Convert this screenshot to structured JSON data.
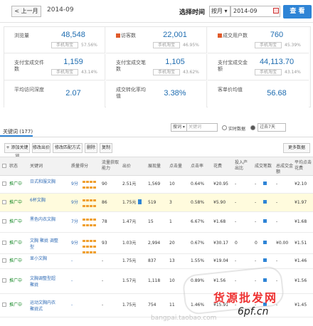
{
  "topbar": {
    "prev_label": "< 上一月",
    "period": "2014-09",
    "picker_title": "选择时间",
    "mode": "按月 ▾",
    "date_value": "2014-09",
    "query_label": "查 看"
  },
  "metrics": [
    {
      "label": "浏览量",
      "value": "48,548",
      "badge": "手机淘宝",
      "pct": "57.56%"
    },
    {
      "label": "访客数",
      "value": "22,001",
      "badge": "手机淘宝",
      "pct": "46.95%"
    },
    {
      "label": "成交用户数",
      "value": "760",
      "badge": "手机淘宝",
      "pct": "45.39%"
    },
    {
      "label": "支付宝成交件数",
      "value": "1,159",
      "badge": "手机淘宝",
      "pct": "43.14%"
    },
    {
      "label": "支付宝成交笔数",
      "value": "1,105",
      "badge": "手机淘宝",
      "pct": "43.62%"
    },
    {
      "label": "支付宝成交金额",
      "value": "44,113.70",
      "badge": "手机淘宝",
      "pct": "43.14%"
    },
    {
      "label": "平均访问深度",
      "value": "2.07",
      "badge": "",
      "pct": ""
    },
    {
      "label": "成交转化率均值",
      "value": "3.38%",
      "badge": "",
      "pct": ""
    },
    {
      "label": "客单价均值",
      "value": "56.68",
      "badge": "",
      "pct": ""
    }
  ],
  "keywords": {
    "title": "关键词 (177)",
    "filter_select": "搜词 ▾",
    "filter_placeholder": "关键词",
    "realtime_label": "实时数据",
    "range_label": "过去7天"
  },
  "toolbar": {
    "add": "+ 添加关键词",
    "bid": "修改出价",
    "match": "修改匹配方式",
    "delete": "删除",
    "copy": "复制",
    "more": "更多数据"
  },
  "columns": [
    "状态",
    "关键词",
    "质量得分",
    "流量获取能力",
    "出价",
    "展现量",
    "点击量",
    "点击率",
    "花费",
    "投入产出比",
    "成交笔数",
    "总成交金额",
    "平均点击花费"
  ],
  "rows": [
    {
      "status": "推广中",
      "keyword": "日式和服文胸",
      "score": "9分",
      "power": "90",
      "bid": "2.51元",
      "impr": "1,569",
      "clicks": "10",
      "ctr": "0.64%",
      "cost": "¥20.95",
      "roi": "-",
      "orders": "-",
      "sales": "-",
      "cpc": "¥2.10"
    },
    {
      "status": "推广中",
      "keyword": "6杯文胸",
      "score": "9分",
      "power": "86",
      "bid": "1.75元",
      "impr": "519",
      "clicks": "3",
      "ctr": "0.58%",
      "cost": "¥5.90",
      "roi": "-",
      "orders": "-",
      "sales": "-",
      "cpc": "¥1.97"
    },
    {
      "status": "推广中",
      "keyword": "黑色内衣文胸",
      "score": "7分",
      "power": "78",
      "bid": "1.47元",
      "impr": "15",
      "clicks": "1",
      "ctr": "6.67%",
      "cost": "¥1.68",
      "roi": "-",
      "orders": "-",
      "sales": "-",
      "cpc": "¥1.68"
    },
    {
      "status": "推广中",
      "keyword": "文胸 聚拢 调整型",
      "score": "9分",
      "power": "93",
      "bid": "1.03元",
      "impr": "2,994",
      "clicks": "20",
      "ctr": "0.67%",
      "cost": "¥30.17",
      "roi": "0",
      "orders": "0",
      "sales": "¥0.00",
      "cpc": "¥1.51"
    },
    {
      "status": "推广中",
      "keyword": "显小文胸",
      "score": "-",
      "power": "-",
      "bid": "1.75元",
      "impr": "837",
      "clicks": "13",
      "ctr": "1.55%",
      "cost": "¥19.04",
      "roi": "-",
      "orders": "-",
      "sales": "-",
      "cpc": "¥1.46"
    },
    {
      "status": "推广中",
      "keyword": "文胸调整型超聚拢",
      "score": "-",
      "power": "-",
      "bid": "1.57元",
      "impr": "1,118",
      "clicks": "10",
      "ctr": "0.89%",
      "cost": "¥1.56",
      "roi": "-",
      "orders": "-",
      "sales": "-",
      "cpc": "¥1.56"
    },
    {
      "status": "推广中",
      "keyword": "运动文胸内衣聚拢式",
      "score": "-",
      "power": "-",
      "bid": "1.75元",
      "impr": "754",
      "clicks": "11",
      "ctr": "1.46%",
      "cost": "¥15.91",
      "roi": "-",
      "orders": "-",
      "sales": "-",
      "cpc": "¥1.45"
    }
  ],
  "watermark": {
    "line1": "货源批发网",
    "line2": "6pf.cn",
    "line3": "bangpai.taobao.com"
  }
}
